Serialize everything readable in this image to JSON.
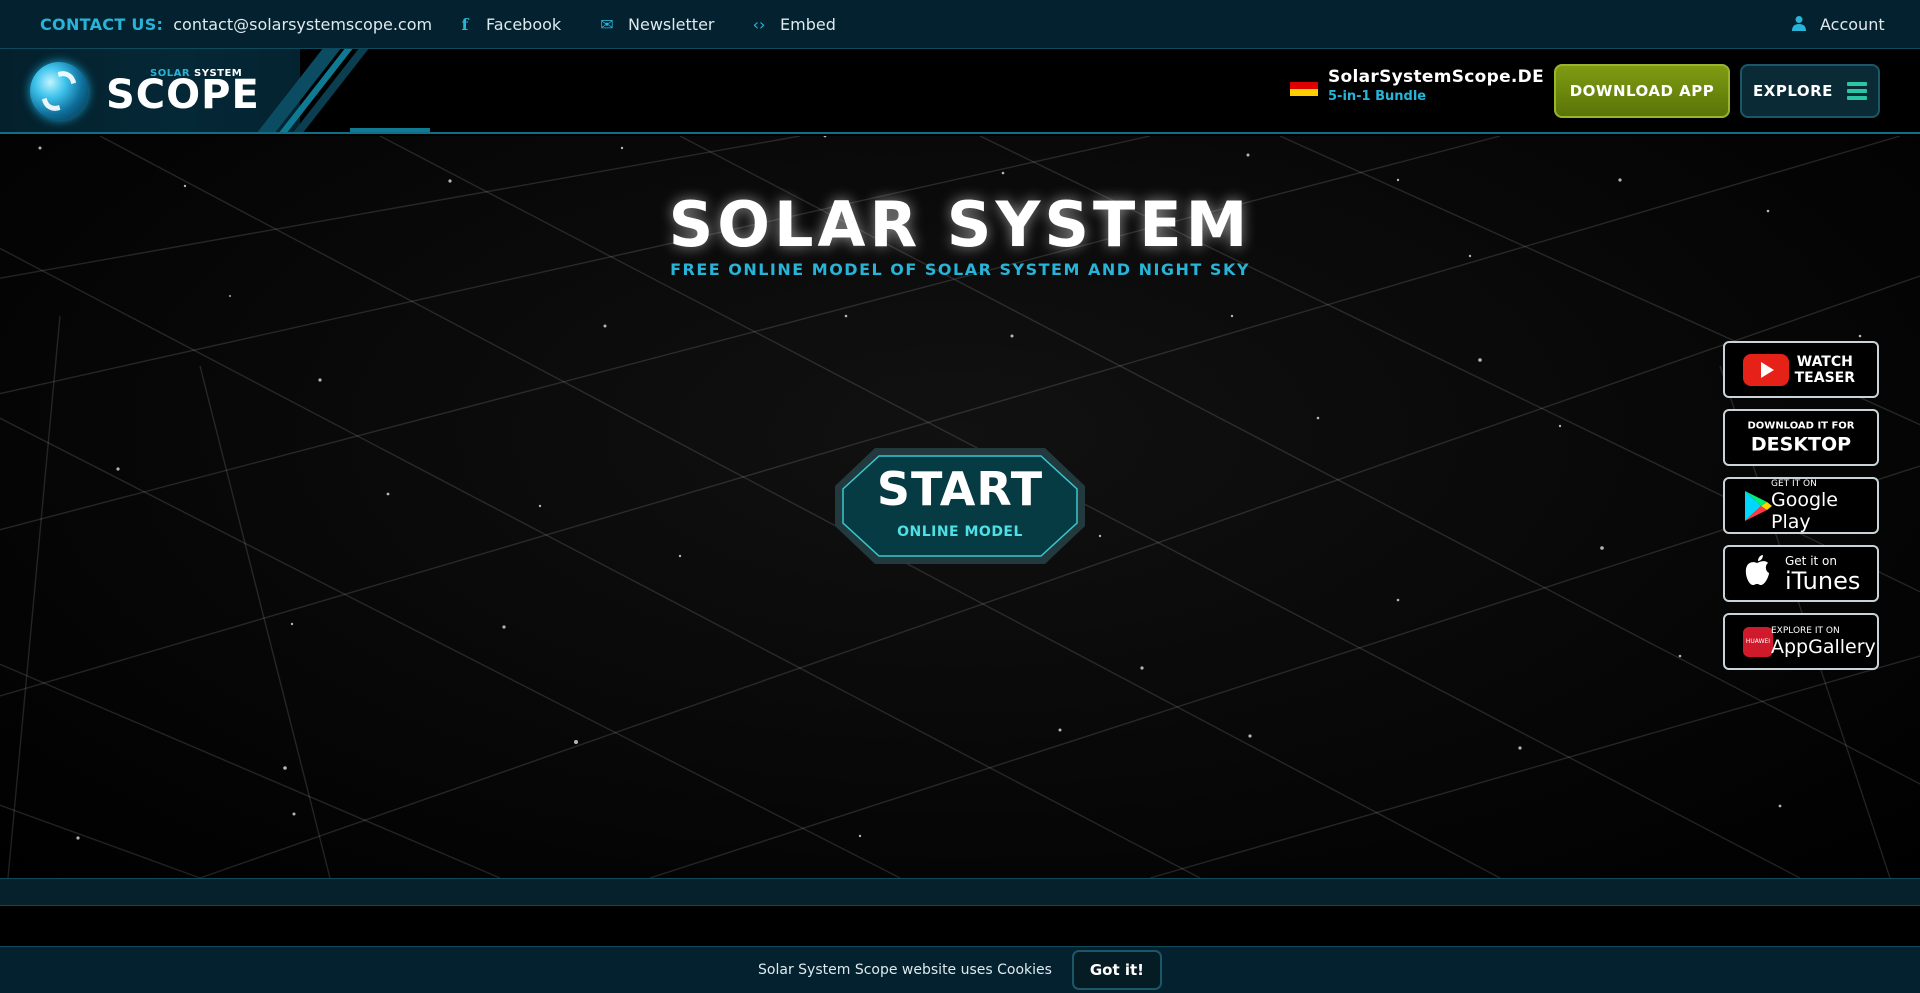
{
  "topbar": {
    "contact_label": "CONTACT US:",
    "contact_email": "contact@solarsystemscope.com",
    "facebook": "Facebook",
    "newsletter": "Newsletter",
    "embed": "Embed",
    "account": "Account"
  },
  "logo": {
    "small_solar": "SOLAR",
    "small_system": "SYSTEM",
    "big": "SCOPE"
  },
  "header": {
    "de_title": "SolarSystemScope.DE",
    "de_sub": "5-in-1 Bundle",
    "download_app": "DOWNLOAD APP",
    "explore": "EXPLORE"
  },
  "hero": {
    "title": "SOLAR SYSTEM",
    "subtitle": "FREE ONLINE MODEL OF SOLAR SYSTEM AND NIGHT SKY",
    "start_big": "START",
    "start_small": "ONLINE MODEL"
  },
  "side_buttons": {
    "teaser_line1": "WATCH",
    "teaser_line2": "TEASER",
    "desktop_small": "DOWNLOAD IT FOR",
    "desktop_big": "DESKTOP",
    "gplay_small": "GET IT ON",
    "gplay_big": "Google Play",
    "itunes_small": "Get it on",
    "itunes_big": "iTunes",
    "appgallery_small": "EXPLORE IT ON",
    "appgallery_big": "AppGallery",
    "huawei_logo": "HUAWEI"
  },
  "cookie": {
    "text": "Solar System Scope website uses Cookies",
    "button": "Got it!"
  },
  "colors": {
    "accent": "#27b4d8",
    "topbar_bg": "#04212f",
    "download_green": "#7f9b12",
    "explore_burger": "#2cc5a4"
  }
}
